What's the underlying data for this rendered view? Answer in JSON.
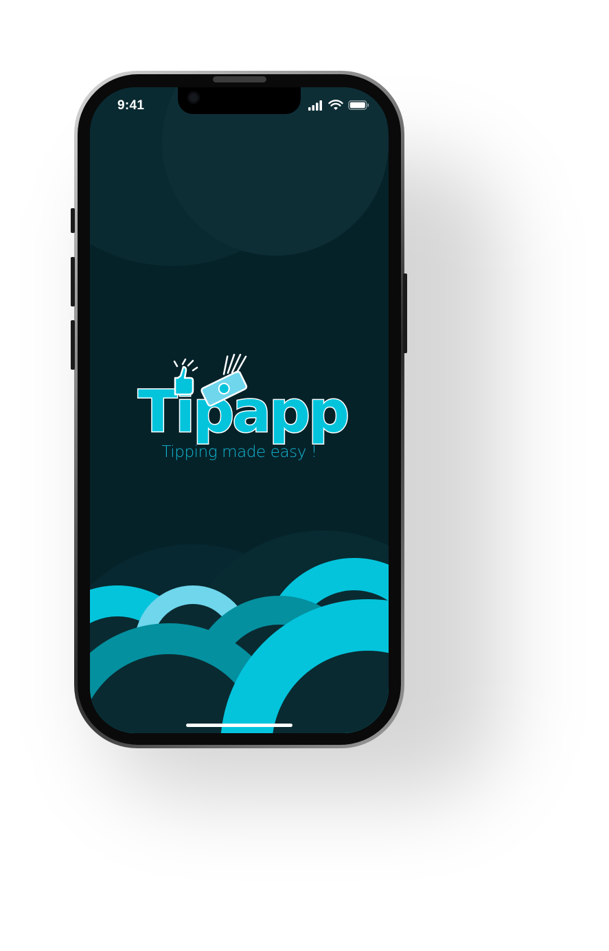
{
  "app": {
    "name": "Tipapp",
    "tagline": "Tipping made easy !"
  },
  "status_bar": {
    "time": "9:41",
    "icons": [
      "cellular-signal-icon",
      "wifi-icon",
      "battery-icon"
    ]
  },
  "colors": {
    "background": "#052229",
    "accent": "#04c4dc",
    "accent_light": "#6fd6ec",
    "accent_dark": "#04909f",
    "tagline": "#14b6d2"
  }
}
